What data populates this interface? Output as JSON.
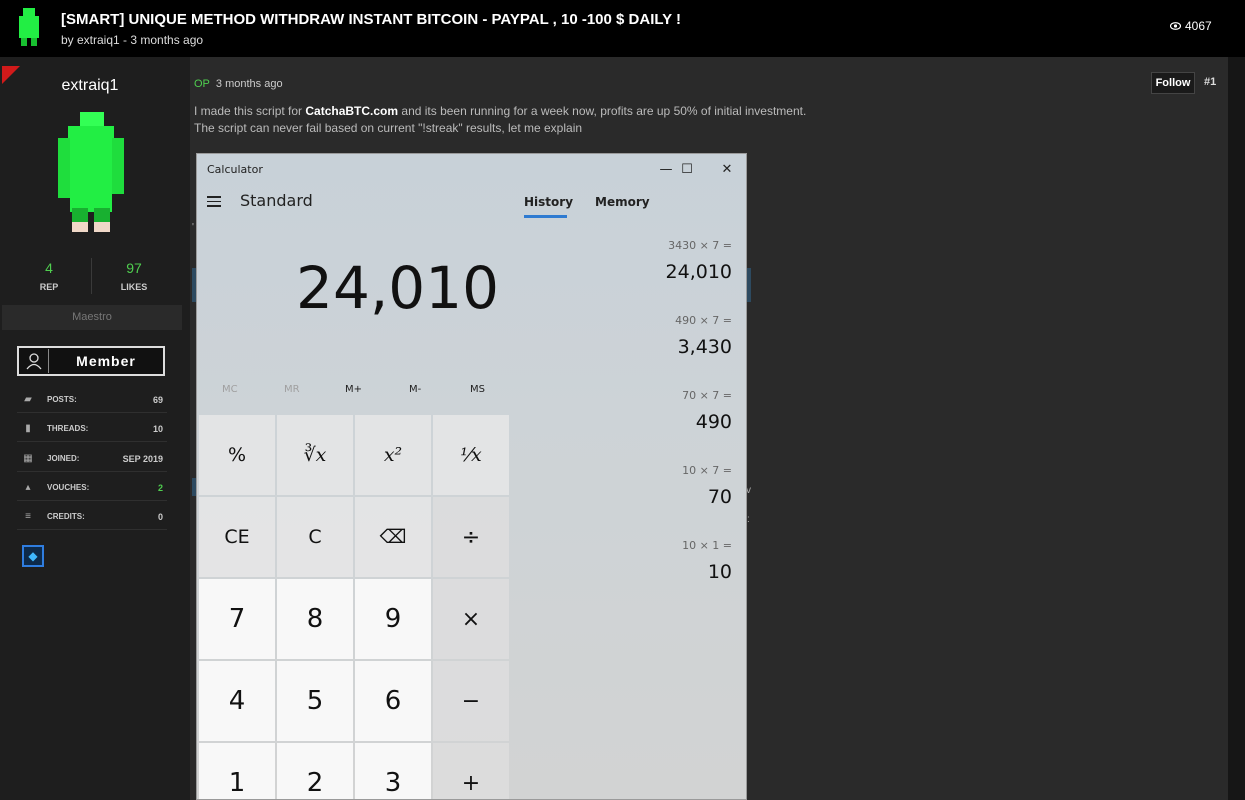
{
  "thread": {
    "title": "[SMART] UNIQUE METHOD WITHDRAW INSTANT BITCOIN - PAYPAL , 10 -100 $ DAILY !",
    "byline": "by extraiq1 - 3 months ago",
    "views": "4067"
  },
  "user": {
    "name": "extraiq1",
    "rep_value": "4",
    "rep_label": "REP",
    "likes_value": "97",
    "likes_label": "LIKES",
    "rank": "Maestro",
    "badge": "Member",
    "stats": [
      {
        "label": "POSTS:",
        "value": "69",
        "icon": "chat-icon"
      },
      {
        "label": "THREADS:",
        "value": "10",
        "icon": "book-icon"
      },
      {
        "label": "JOINED:",
        "value": "SEP 2019",
        "icon": "calendar-icon"
      },
      {
        "label": "VOUCHES:",
        "value": "2",
        "icon": "thumbs-up-icon",
        "color": "#4fce4f"
      },
      {
        "label": "CREDITS:",
        "value": "0",
        "icon": "coins-icon"
      }
    ]
  },
  "post": {
    "op_tag": "OP",
    "time": "3 months ago",
    "follow_label": "Follow",
    "number": "#1",
    "line1_before": "I made this script for ",
    "line1_link": "CatchaBTC.com",
    "line1_after": " and its been running for a week now, profits are up 50% of initial investment.",
    "line2": "The script can never fail based on current \"!streak\" results, let me explain"
  },
  "calculator": {
    "window_title": "Calculator",
    "mode": "Standard",
    "tab_history": "History",
    "tab_memory": "Memory",
    "display": "24,010",
    "memory_buttons": [
      {
        "label": "MC",
        "enabled": false
      },
      {
        "label": "MR",
        "enabled": false
      },
      {
        "label": "M+",
        "enabled": true
      },
      {
        "label": "M-",
        "enabled": true
      },
      {
        "label": "MS",
        "enabled": true
      }
    ],
    "keys": [
      [
        "%",
        "∛x",
        "x²",
        "⅟x"
      ],
      [
        "CE",
        "C",
        "⌫",
        "÷"
      ],
      [
        "7",
        "8",
        "9",
        "×"
      ],
      [
        "4",
        "5",
        "6",
        "−"
      ],
      [
        "1",
        "2",
        "3",
        "+"
      ]
    ],
    "history": [
      {
        "expr": "3430   ×   7 =",
        "result": "24,010"
      },
      {
        "expr": "490   ×   7 =",
        "result": "3,430"
      },
      {
        "expr": "70   ×   7 =",
        "result": "490"
      },
      {
        "expr": "10   ×   7 =",
        "result": "70"
      },
      {
        "expr": "10   ×   1 =",
        "result": "10"
      }
    ]
  },
  "colors": {
    "accent_green": "#4fce4f",
    "history_underline": "#2e7bd1",
    "corner_flag": "#d11a1a"
  }
}
